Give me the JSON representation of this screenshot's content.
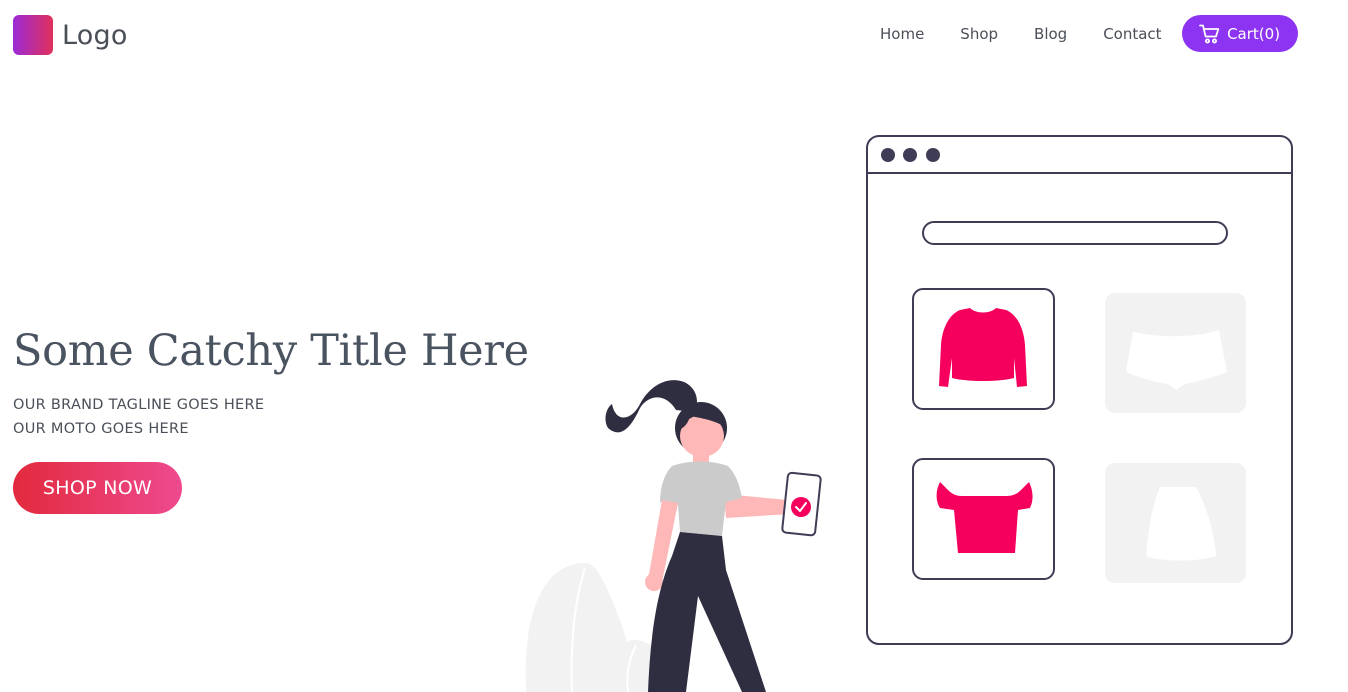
{
  "header": {
    "logo_text": "Logo",
    "nav": [
      "Home",
      "Shop",
      "Blog",
      "Contact"
    ],
    "cart_label": "Cart(0)"
  },
  "hero": {
    "title": "Some Catchy Title Here",
    "tagline_1": "OUR BRAND TAGLINE GOES HERE",
    "tagline_2": "OUR MOTO GOES HERE",
    "cta": "SHOP NOW"
  },
  "colors": {
    "accent_purple": "#8d33f2",
    "product_pink": "#f5005d",
    "outline_dark": "#3f3d56",
    "placeholder_gray": "#f2f2f2"
  },
  "icons": [
    "cart-icon",
    "logo-mark",
    "check-icon"
  ]
}
